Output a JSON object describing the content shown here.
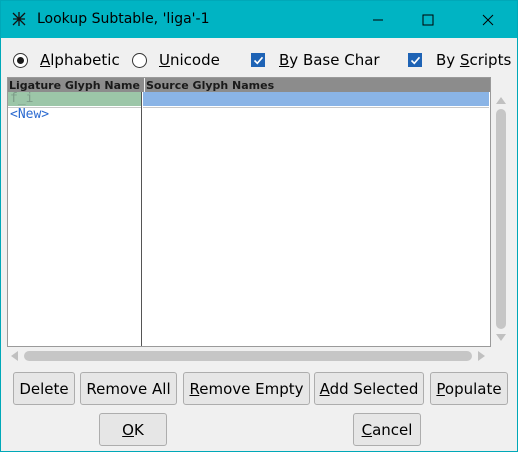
{
  "window": {
    "title": "Lookup Subtable, 'liga'-1"
  },
  "options": {
    "alphabetic_first": "A",
    "alphabetic_rest": "lphabetic",
    "unicode_first": "U",
    "unicode_rest": "nicode",
    "by_base_char_first": "B",
    "by_base_char_rest": "y Base Char",
    "by_scripts_first": "By ",
    "by_scripts_ul": "S",
    "by_scripts_rest": "cripts",
    "alphabetic_selected": true,
    "unicode_selected": false,
    "by_base_char_checked": true,
    "by_scripts_checked": true
  },
  "table": {
    "columns": [
      "Ligature Glyph Name",
      "Source Glyph Names"
    ],
    "rows": [
      {
        "ligature": "f_i",
        "source": ""
      }
    ],
    "new_label": "<New>"
  },
  "buttons": {
    "delete": "Delete",
    "remove_all": "Remove All",
    "remove_empty_first": "R",
    "remove_empty_rest": "emove Empty",
    "add_selected_first": "A",
    "add_selected_rest": "dd Selected",
    "populate_first": "P",
    "populate_rest": "opulate",
    "ok_first": "O",
    "ok_rest": "K",
    "cancel_first": "C",
    "cancel_rest": "ancel"
  },
  "colors": {
    "titlebar": "#00b4c3",
    "selected_ligature_cell": "#9cc6a8",
    "selected_source_cell": "#8ab4e6",
    "new_text": "#2b6ad0",
    "checkbox": "#1e63b5"
  }
}
